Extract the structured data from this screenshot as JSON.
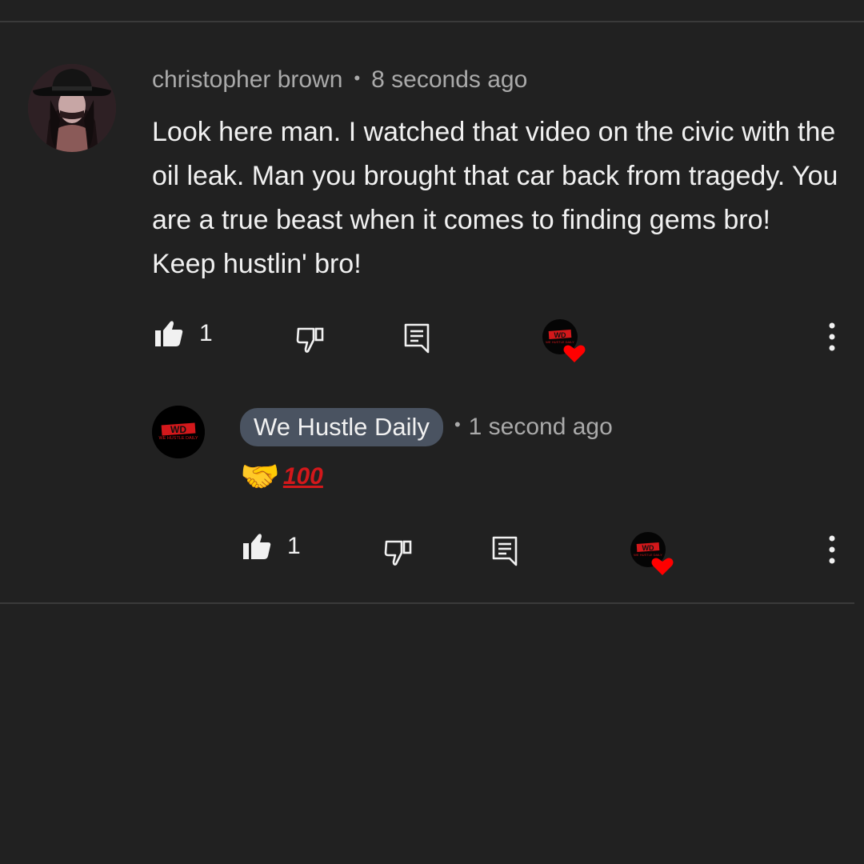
{
  "comment": {
    "author": "christopher brown",
    "separator": "•",
    "timestamp": "8 seconds ago",
    "text": "Look here man. I watched that video on the civic with the oil leak. Man you brought that car back from tragedy. You are a true beast when it comes to finding gems bro! Keep hustlin' bro!",
    "like_count": "1"
  },
  "reply": {
    "author": "We Hustle Daily",
    "separator": "•",
    "timestamp": "1 second ago",
    "emoji_handshake": "🤝",
    "emoji_hundred": "100",
    "like_count": "1"
  },
  "channel_logo": {
    "text": "WD",
    "subtitle": "WE HUSTLE DAILY"
  },
  "icons": {
    "like": "thumbs-up-icon",
    "dislike": "thumbs-down-icon",
    "reply": "reply-icon",
    "creator_heart": "heart-icon",
    "more": "more-vertical-icon"
  },
  "colors": {
    "background": "#212121",
    "text_primary": "#f1f1f1",
    "text_secondary": "#aaaaaa",
    "owner_badge": "#4a5361",
    "heart": "#ff0000",
    "logo_red": "#d3181b"
  }
}
